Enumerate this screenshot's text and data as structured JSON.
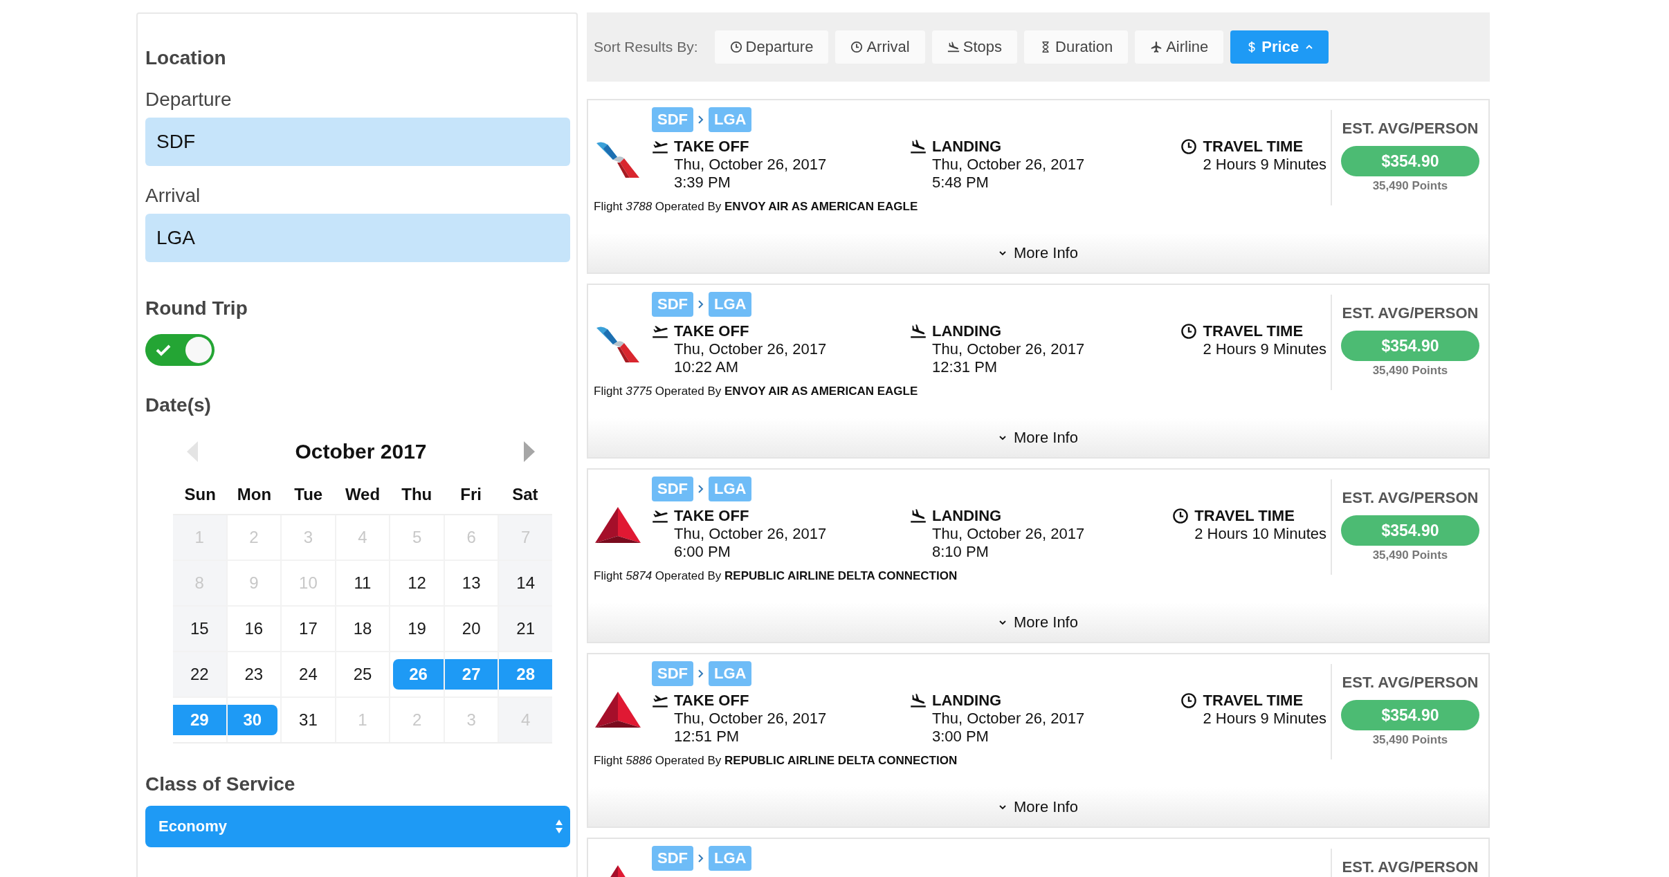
{
  "sidebar": {
    "location_heading": "Location",
    "departure": {
      "label": "Departure",
      "value": "SDF"
    },
    "arrival": {
      "label": "Arrival",
      "value": "LGA"
    },
    "round_trip": {
      "label": "Round Trip",
      "on": true
    },
    "dates_heading": "Date(s)",
    "calendar": {
      "month": "October 2017",
      "nav": [
        {
          "disabled": true
        },
        {
          "disabled": false
        }
      ],
      "weekdays": [
        "Sun",
        "Mon",
        "Tue",
        "Wed",
        "Thu",
        "Fri",
        "Sat"
      ],
      "days": [
        {
          "text": "1",
          "muted": true,
          "selected": false
        },
        {
          "text": "2",
          "muted": true,
          "selected": false
        },
        {
          "text": "3",
          "muted": true,
          "selected": false
        },
        {
          "text": "4",
          "muted": true,
          "selected": false
        },
        {
          "text": "5",
          "muted": true,
          "selected": false
        },
        {
          "text": "6",
          "muted": true,
          "selected": false
        },
        {
          "text": "7",
          "muted": true,
          "selected": false
        },
        {
          "text": "8",
          "muted": true,
          "selected": false
        },
        {
          "text": "9",
          "muted": true,
          "selected": false
        },
        {
          "text": "10",
          "muted": true,
          "selected": false
        },
        {
          "text": "11",
          "muted": false,
          "selected": false
        },
        {
          "text": "12",
          "muted": false,
          "selected": false
        },
        {
          "text": "13",
          "muted": false,
          "selected": false
        },
        {
          "text": "14",
          "muted": false,
          "selected": false
        },
        {
          "text": "15",
          "muted": false,
          "selected": false
        },
        {
          "text": "16",
          "muted": false,
          "selected": false
        },
        {
          "text": "17",
          "muted": false,
          "selected": false
        },
        {
          "text": "18",
          "muted": false,
          "selected": false
        },
        {
          "text": "19",
          "muted": false,
          "selected": false
        },
        {
          "text": "20",
          "muted": false,
          "selected": false
        },
        {
          "text": "21",
          "muted": false,
          "selected": false
        },
        {
          "text": "22",
          "muted": false,
          "selected": false
        },
        {
          "text": "23",
          "muted": false,
          "selected": false
        },
        {
          "text": "24",
          "muted": false,
          "selected": false
        },
        {
          "text": "25",
          "muted": false,
          "selected": false
        },
        {
          "text": "26",
          "muted": false,
          "selected": true
        },
        {
          "text": "27",
          "muted": false,
          "selected": true
        },
        {
          "text": "28",
          "muted": false,
          "selected": true
        },
        {
          "text": "29",
          "muted": false,
          "selected": true
        },
        {
          "text": "30",
          "muted": false,
          "selected": true
        },
        {
          "text": "31",
          "muted": false,
          "selected": false
        },
        {
          "text": "1",
          "muted": true,
          "selected": false
        },
        {
          "text": "2",
          "muted": true,
          "selected": false
        },
        {
          "text": "3",
          "muted": true,
          "selected": false
        },
        {
          "text": "4",
          "muted": true,
          "selected": false
        }
      ]
    },
    "class_of_service": {
      "label": "Class of Service",
      "value": "Economy"
    }
  },
  "sort_bar": {
    "label": "Sort Results By:",
    "options": [
      {
        "label": "Departure",
        "selected": false
      },
      {
        "label": "Arrival",
        "selected": false
      },
      {
        "label": "Stops",
        "selected": false
      },
      {
        "label": "Duration",
        "selected": false
      },
      {
        "label": "Airline",
        "selected": false
      },
      {
        "label": "Price",
        "selected": true
      }
    ]
  },
  "flights": [
    {
      "kind": "american",
      "origin": "SDF",
      "destination": "LGA",
      "takeoff": {
        "label": "TAKE OFF",
        "date": "Thu, October 26, 2017",
        "time": "3:39 PM"
      },
      "landing": {
        "label": "LANDING",
        "date": "Thu, October 26, 2017",
        "time": "5:48 PM"
      },
      "travel_time": {
        "label": "TRAVEL TIME",
        "value": "2 Hours 9 Minutes"
      },
      "flight_line": "Flight *3788* Operated By **ENVOY AIR AS AMERICAN EAGLE**",
      "price_label": "EST. AVG/PERSON",
      "price": "$354.90",
      "points": "35,490 Points",
      "more_info": "More Info"
    },
    {
      "kind": "american",
      "origin": "SDF",
      "destination": "LGA",
      "takeoff": {
        "label": "TAKE OFF",
        "date": "Thu, October 26, 2017",
        "time": "10:22 AM"
      },
      "landing": {
        "label": "LANDING",
        "date": "Thu, October 26, 2017",
        "time": "12:31 PM"
      },
      "travel_time": {
        "label": "TRAVEL TIME",
        "value": "2 Hours 9 Minutes"
      },
      "flight_line": "Flight *3775* Operated By **ENVOY AIR AS AMERICAN EAGLE**",
      "price_label": "EST. AVG/PERSON",
      "price": "$354.90",
      "points": "35,490 Points",
      "more_info": "More Info"
    },
    {
      "kind": "delta",
      "origin": "SDF",
      "destination": "LGA",
      "takeoff": {
        "label": "TAKE OFF",
        "date": "Thu, October 26, 2017",
        "time": "6:00 PM"
      },
      "landing": {
        "label": "LANDING",
        "date": "Thu, October 26, 2017",
        "time": "8:10 PM"
      },
      "travel_time": {
        "label": "TRAVEL TIME",
        "value": "2 Hours 10 Minutes"
      },
      "flight_line": "Flight *5874* Operated By **REPUBLIC AIRLINE DELTA CONNECTION**",
      "price_label": "EST. AVG/PERSON",
      "price": "$354.90",
      "points": "35,490 Points",
      "more_info": "More Info"
    },
    {
      "kind": "delta",
      "origin": "SDF",
      "destination": "LGA",
      "takeoff": {
        "label": "TAKE OFF",
        "date": "Thu, October 26, 2017",
        "time": "12:51 PM"
      },
      "landing": {
        "label": "LANDING",
        "date": "Thu, October 26, 2017",
        "time": "3:00 PM"
      },
      "travel_time": {
        "label": "TRAVEL TIME",
        "value": "2 Hours 9 Minutes"
      },
      "flight_line": "Flight *5886* Operated By **REPUBLIC AIRLINE DELTA CONNECTION**",
      "price_label": "EST. AVG/PERSON",
      "price": "$354.90",
      "points": "35,490 Points",
      "more_info": "More Info"
    },
    {
      "kind": "delta",
      "origin": "SDF",
      "destination": "LGA",
      "price_label": "EST. AVG/PERSON"
    }
  ]
}
